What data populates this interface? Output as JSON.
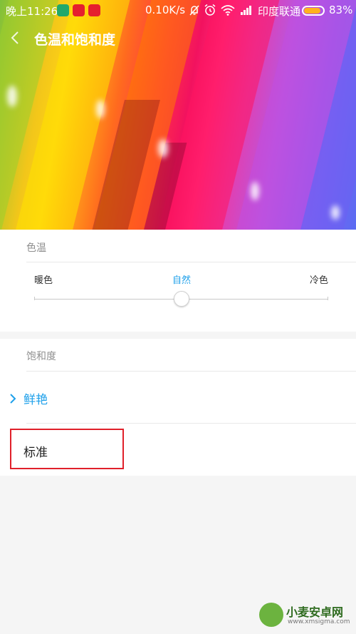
{
  "status_bar": {
    "time": "晚上11:26",
    "net_speed": "0.10K/s",
    "carrier": "印度联通",
    "battery": "83%",
    "battery_level": 0.83
  },
  "header": {
    "title": "色温和饱和度"
  },
  "color_temp": {
    "section_label": "色温",
    "warm_label": "暖色",
    "natural_label": "自然",
    "cool_label": "冷色",
    "slider_value": 0.5,
    "accent_color": "#1ea0ea"
  },
  "saturation": {
    "section_label": "饱和度",
    "options": [
      {
        "label": "鲜艳",
        "selected": true
      },
      {
        "label": "标准",
        "selected": false
      }
    ]
  },
  "watermark": {
    "name": "小麦安卓网",
    "url": "www.xmsigma.com"
  }
}
